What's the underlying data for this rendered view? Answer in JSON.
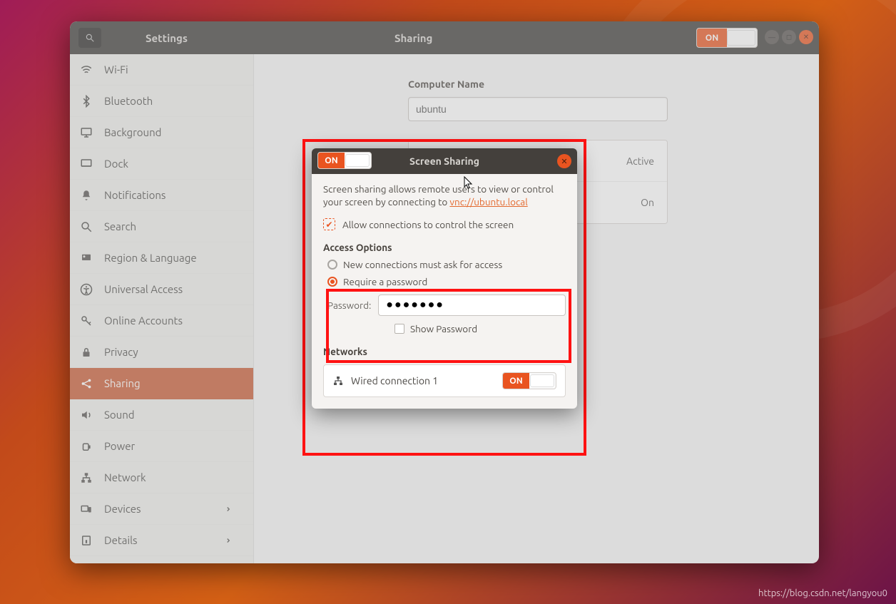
{
  "header": {
    "app_title": "Settings",
    "panel_title": "Sharing",
    "toggle_label": "ON"
  },
  "sidebar": {
    "items": [
      {
        "id": "wifi",
        "label": "Wi-Fi"
      },
      {
        "id": "bluetooth",
        "label": "Bluetooth"
      },
      {
        "id": "background",
        "label": "Background"
      },
      {
        "id": "dock",
        "label": "Dock"
      },
      {
        "id": "notifications",
        "label": "Notifications"
      },
      {
        "id": "search",
        "label": "Search"
      },
      {
        "id": "region",
        "label": "Region & Language"
      },
      {
        "id": "universal-access",
        "label": "Universal Access"
      },
      {
        "id": "online-accounts",
        "label": "Online Accounts"
      },
      {
        "id": "privacy",
        "label": "Privacy"
      },
      {
        "id": "sharing",
        "label": "Sharing"
      },
      {
        "id": "sound",
        "label": "Sound"
      },
      {
        "id": "power",
        "label": "Power"
      },
      {
        "id": "network",
        "label": "Network"
      },
      {
        "id": "devices",
        "label": "Devices",
        "chevron": true
      },
      {
        "id": "details",
        "label": "Details",
        "chevron": true
      }
    ],
    "selected": "sharing"
  },
  "content": {
    "computer_name_label": "Computer Name",
    "computer_name_value": "ubuntu",
    "share_rows": [
      {
        "name": "Screen Sharing",
        "state": "Active"
      },
      {
        "name": "",
        "state": "On"
      }
    ]
  },
  "dialog": {
    "toggle_label": "ON",
    "title": "Screen Sharing",
    "description_a": "Screen sharing allows remote users to view or control your screen by connecting to ",
    "vnc_link": "vnc://ubuntu.local",
    "allow_control_label": "Allow connections to control the screen",
    "allow_control_checked": true,
    "access_options_heading": "Access Options",
    "radio_ask": "New connections must ask for access",
    "radio_password": "Require a password",
    "radio_selected": "password",
    "password_label": "Password:",
    "password_value": "●●●●●●●",
    "show_password_label": "Show Password",
    "show_password_checked": false,
    "networks_heading": "Networks",
    "networks": [
      {
        "name": "Wired connection 1",
        "on": true,
        "toggle_label": "ON"
      }
    ]
  },
  "watermark": "https://blog.csdn.net/langyou0"
}
